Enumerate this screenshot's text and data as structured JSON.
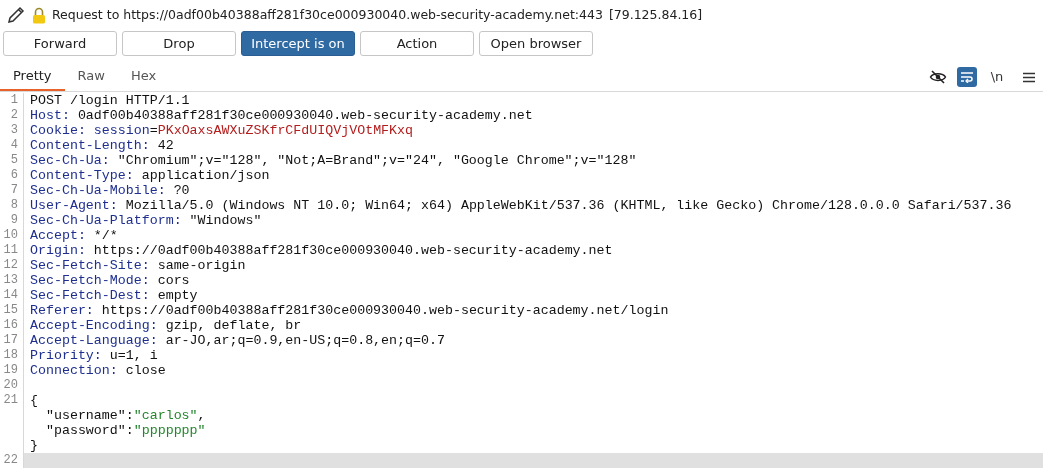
{
  "header": {
    "request": "Request to https://0adf00b40388aff281f30ce000930040.web-security-academy.net:443",
    "ip": "[79.125.84.16]"
  },
  "buttons": [
    {
      "label": "Forward",
      "on": false
    },
    {
      "label": "Drop",
      "on": false
    },
    {
      "label": "Intercept is on",
      "on": true
    },
    {
      "label": "Action",
      "on": false
    },
    {
      "label": "Open browser",
      "on": false
    }
  ],
  "tabs": [
    {
      "label": "Pretty",
      "selected": true
    },
    {
      "label": "Raw",
      "selected": false
    },
    {
      "label": "Hex",
      "selected": false
    }
  ],
  "toolbar": {
    "hide_toggle_on": false,
    "wrap_toggle_on": true,
    "newline_label": "\\n"
  },
  "lines": [
    {
      "number": "1",
      "current": false,
      "segments": [
        {
          "kind": "plain",
          "text": "POST /login HTTP/1.1"
        }
      ]
    },
    {
      "number": "2",
      "current": false,
      "segments": [
        {
          "kind": "name",
          "text": "Host:"
        },
        {
          "kind": "plain",
          "text": " 0adf00b40388aff281f30ce000930040.web-security-academy.net"
        }
      ]
    },
    {
      "number": "3",
      "current": false,
      "segments": [
        {
          "kind": "name",
          "text": "Cookie: session"
        },
        {
          "kind": "plain",
          "text": "="
        },
        {
          "kind": "cookie",
          "text": "PKxOaxsAWXuZSKfrCFdUIQVjVOtMFKxq"
        }
      ]
    },
    {
      "number": "4",
      "current": false,
      "segments": [
        {
          "kind": "name",
          "text": "Content-Length:"
        },
        {
          "kind": "plain",
          "text": " 42"
        }
      ]
    },
    {
      "number": "5",
      "current": false,
      "segments": [
        {
          "kind": "name",
          "text": "Sec-Ch-Ua:"
        },
        {
          "kind": "plain",
          "text": " \"Chromium\";v=\"128\", \"Not;A=Brand\";v=\"24\", \"Google Chrome\";v=\"128\""
        }
      ]
    },
    {
      "number": "6",
      "current": false,
      "segments": [
        {
          "kind": "name",
          "text": "Content-Type:"
        },
        {
          "kind": "plain",
          "text": " application/json"
        }
      ]
    },
    {
      "number": "7",
      "current": false,
      "segments": [
        {
          "kind": "name",
          "text": "Sec-Ch-Ua-Mobile:"
        },
        {
          "kind": "plain",
          "text": " ?0"
        }
      ]
    },
    {
      "number": "8",
      "current": false,
      "segments": [
        {
          "kind": "name",
          "text": "User-Agent:"
        },
        {
          "kind": "plain",
          "text": " Mozilla/5.0 (Windows NT 10.0; Win64; x64) AppleWebKit/537.36 (KHTML, like Gecko) Chrome/128.0.0.0 Safari/537.36"
        }
      ]
    },
    {
      "number": "9",
      "current": false,
      "segments": [
        {
          "kind": "name",
          "text": "Sec-Ch-Ua-Platform:"
        },
        {
          "kind": "plain",
          "text": " \"Windows\""
        }
      ]
    },
    {
      "number": "10",
      "current": false,
      "segments": [
        {
          "kind": "name",
          "text": "Accept:"
        },
        {
          "kind": "plain",
          "text": " */*"
        }
      ]
    },
    {
      "number": "11",
      "current": false,
      "segments": [
        {
          "kind": "name",
          "text": "Origin:"
        },
        {
          "kind": "plain",
          "text": " https://0adf00b40388aff281f30ce000930040.web-security-academy.net"
        }
      ]
    },
    {
      "number": "12",
      "current": false,
      "segments": [
        {
          "kind": "name",
          "text": "Sec-Fetch-Site:"
        },
        {
          "kind": "plain",
          "text": " same-origin"
        }
      ]
    },
    {
      "number": "13",
      "current": false,
      "segments": [
        {
          "kind": "name",
          "text": "Sec-Fetch-Mode:"
        },
        {
          "kind": "plain",
          "text": " cors"
        }
      ]
    },
    {
      "number": "14",
      "current": false,
      "segments": [
        {
          "kind": "name",
          "text": "Sec-Fetch-Dest:"
        },
        {
          "kind": "plain",
          "text": " empty"
        }
      ]
    },
    {
      "number": "15",
      "current": false,
      "segments": [
        {
          "kind": "name",
          "text": "Referer:"
        },
        {
          "kind": "plain",
          "text": " https://0adf00b40388aff281f30ce000930040.web-security-academy.net/login"
        }
      ]
    },
    {
      "number": "16",
      "current": false,
      "segments": [
        {
          "kind": "name",
          "text": "Accept-Encoding:"
        },
        {
          "kind": "plain",
          "text": " gzip, deflate, br"
        }
      ]
    },
    {
      "number": "17",
      "current": false,
      "segments": [
        {
          "kind": "name",
          "text": "Accept-Language:"
        },
        {
          "kind": "plain",
          "text": " ar-JO,ar;q=0.9,en-US;q=0.8,en;q=0.7"
        }
      ]
    },
    {
      "number": "18",
      "current": false,
      "segments": [
        {
          "kind": "name",
          "text": "Priority:"
        },
        {
          "kind": "plain",
          "text": " u=1, i"
        }
      ]
    },
    {
      "number": "19",
      "current": false,
      "segments": [
        {
          "kind": "name",
          "text": "Connection:"
        },
        {
          "kind": "plain",
          "text": " close"
        }
      ]
    },
    {
      "number": "20",
      "current": false
    },
    {
      "number": "21",
      "current": false,
      "segments": [
        {
          "kind": "plain",
          "text": "{"
        }
      ]
    },
    {
      "current": false,
      "segments": [
        {
          "kind": "plain",
          "text": "  \"username\":"
        },
        {
          "kind": "string",
          "text": "\"carlos\""
        },
        {
          "kind": "plain",
          "text": ","
        }
      ]
    },
    {
      "current": false,
      "segments": [
        {
          "kind": "plain",
          "text": "  \"password\":"
        },
        {
          "kind": "string",
          "text": "\"ppppppp\""
        }
      ]
    },
    {
      "current": false,
      "segments": [
        {
          "kind": "plain",
          "text": "}"
        }
      ]
    },
    {
      "number": "22",
      "current": true
    }
  ]
}
